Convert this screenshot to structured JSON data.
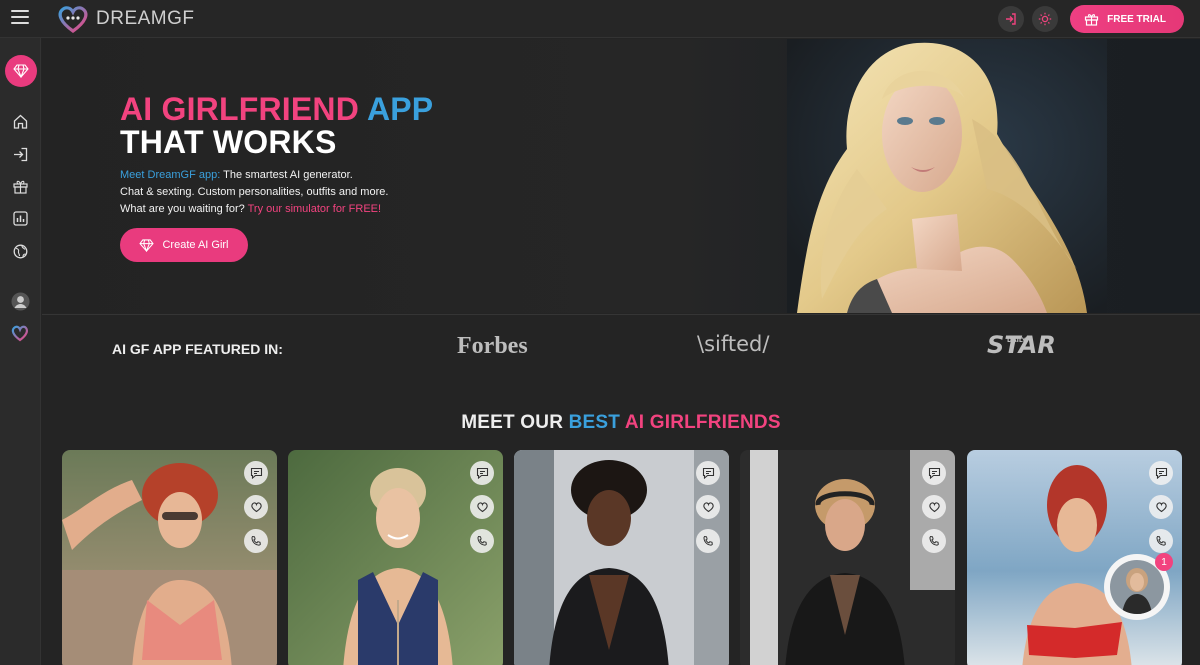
{
  "header": {
    "logo_text": "DREAMGF",
    "free_trial_label": "FREE TRIAL"
  },
  "sidebar": {
    "items": [
      "gem-icon",
      "home-icon",
      "login-icon",
      "gift-icon",
      "stats-icon",
      "globe-icon",
      "avatar-icon",
      "heart-logo-icon"
    ]
  },
  "hero": {
    "title_line1_pink": "AI GIRLFRIEND",
    "title_line1_blue": "APP",
    "title_line2": "THAT WORKS",
    "desc_link": "Meet DreamGF app:",
    "desc_line1_rest": " The smartest AI generator.",
    "desc_line2": "Chat & sexting. Custom personalities, outfits and more.",
    "desc_line3_pre": "What are you waiting for? ",
    "desc_line3_link": "Try our simulator for FREE!",
    "cta_label": "Create AI Girl"
  },
  "featured": {
    "label": "AI GF APP FEATURED IN:",
    "press": [
      "Forbes",
      "\\sifted/",
      "STAR",
      "DAILY"
    ]
  },
  "section": {
    "title_pre": "MEET OUR ",
    "title_blue": "BEST",
    "title_pink": " AI GIRLFRIENDS"
  },
  "chat_widget": {
    "badge_count": "1"
  },
  "colors": {
    "accent_pink": "#e93b7e",
    "accent_blue": "#3aa0dd",
    "background": "#242424"
  }
}
